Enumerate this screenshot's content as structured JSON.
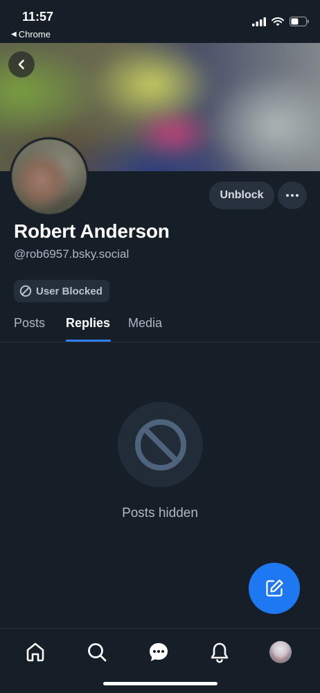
{
  "status_bar": {
    "time": "11:57",
    "back_app": "Chrome",
    "icons": [
      "cellular-signal-icon",
      "wifi-icon",
      "battery-icon"
    ]
  },
  "profile": {
    "display_name": "Robert Anderson",
    "handle": "@rob6957.bsky.social",
    "blocked_badge": "User Blocked",
    "unblock_label": "Unblock"
  },
  "tabs": [
    {
      "label": "Posts",
      "active": false
    },
    {
      "label": "Replies",
      "active": true
    },
    {
      "label": "Media",
      "active": false
    }
  ],
  "empty_state": {
    "message": "Posts hidden"
  },
  "bottom_nav": [
    "home-icon",
    "search-icon",
    "chat-icon",
    "bell-icon",
    "profile-avatar"
  ],
  "colors": {
    "background": "#161e27",
    "accent": "#1d78f2",
    "tab_underline": "#2f7ff5",
    "muted_text": "#aeb8c4"
  }
}
